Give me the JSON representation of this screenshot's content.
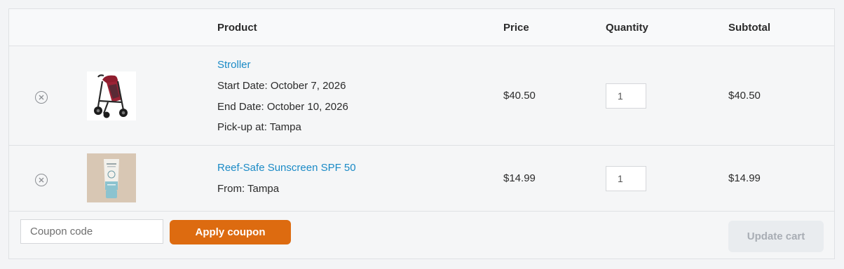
{
  "table": {
    "headers": {
      "product": "Product",
      "price": "Price",
      "quantity": "Quantity",
      "subtotal": "Subtotal"
    }
  },
  "items": [
    {
      "name": "Stroller",
      "details": [
        "Start Date: October 7, 2026",
        "End Date: October 10, 2026",
        "Pick-up at: Tampa"
      ],
      "price": "$40.50",
      "quantity": "1",
      "subtotal": "$40.50",
      "thumbnail_icon": "stroller-image"
    },
    {
      "name": "Reef-Safe Sunscreen SPF 50",
      "details": [
        "From: Tampa"
      ],
      "price": "$14.99",
      "quantity": "1",
      "subtotal": "$14.99",
      "thumbnail_icon": "sunscreen-tube-image"
    }
  ],
  "coupon": {
    "placeholder": "Coupon code",
    "apply_label": "Apply coupon"
  },
  "update_label": "Update cart",
  "colors": {
    "accent": "#dd6b10",
    "link": "#1a8ac6",
    "disabled_button_bg": "#e9ecef",
    "disabled_button_text": "#a8adb4"
  }
}
